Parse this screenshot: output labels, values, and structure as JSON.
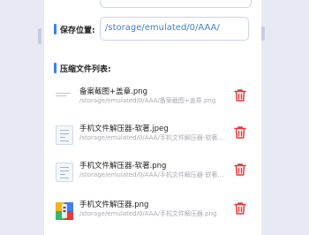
{
  "save_location": {
    "label": "保存位置:",
    "value": "/storage/emulated/0/AAA/"
  },
  "file_list": {
    "title": "压缩文件列表:",
    "items": [
      {
        "name": "备案截图+盖章.png",
        "path": "/storage/emulated/0/AAA/备案截图+盖章.png",
        "thumb": "blank-image-icon"
      },
      {
        "name": "手机文件解压器-软著.jpeg",
        "path": "/storage/emulated/0/AAA/手机文件解压器-软著.jpeg",
        "thumb": "document-image-icon"
      },
      {
        "name": "手机文件解压器-软著.png",
        "path": "/storage/emulated/0/AAA/手机文件解压器-软著.png",
        "thumb": "document-image-icon"
      },
      {
        "name": "手机文件解压器.png",
        "path": "/storage/emulated/0/AAA/手机文件解压器.png",
        "thumb": "app-logo-icon"
      }
    ]
  },
  "colors": {
    "accent": "#3d7ff1",
    "delete": "#e5393b",
    "path_text": "#3f7fd9"
  }
}
